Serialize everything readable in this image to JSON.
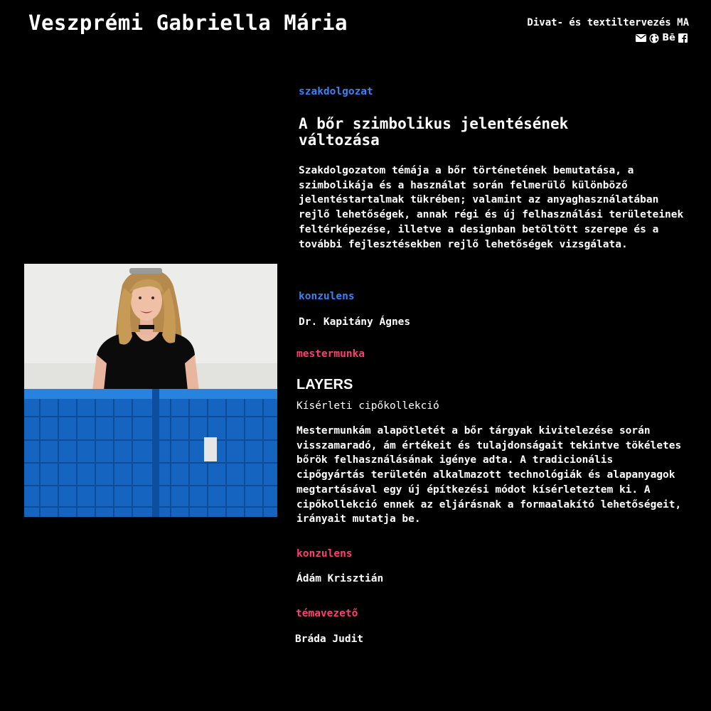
{
  "header": {
    "name": "Veszprémi Gabriella Mária",
    "program": "Divat- és textiltervezés MA",
    "social_icons": [
      "envelope-icon",
      "globe-icon",
      "behance-icon",
      "facebook-icon"
    ],
    "behance_label": "Bē"
  },
  "colors": {
    "background": "#000000",
    "thesis_accent": "#3b82f6",
    "masterwork_accent": "#ff3d6e",
    "text": "#ffffff"
  },
  "thesis": {
    "label": "szakdolgozat",
    "title": "A bőr szimbolikus jelentésének változása",
    "description": "Szakdolgozatom témája a bőr történetének bemutatása, a szimbolikája és a használat során felmerülő különböző jelentéstartalmak tükrében; valamint az anyaghasználatában rejlő lehetőségek, annak régi és új felhasználási területeinek feltérképezése, illetve a designban betöltött szerepe és a további fejlesztésekben rejlő lehetőségek vizsgálata.",
    "consultant_label": "konzulens",
    "consultant": "Dr. Kapitány Ágnes"
  },
  "masterwork": {
    "label": "mestermunka",
    "title": "LAYERS",
    "subtitle": "Kísérleti cipőkollekció",
    "description": "Mestermunkám alapötletét a bőr tárgyak kivitelezése során visszamaradó, ám értékeit és tulajdonságait tekintve tökéletes bőrök felhasználásának igénye adta. A tradicionális cipőgyártás területén alkalmazott technológiák és alapanyagok megtartásával egy új építkezési módot kísérleteztem ki. A cipőkollekció ennek az eljárásnak a formaalakító lehetőségeit, irányait mutatja be.",
    "consultant_label": "konzulens",
    "consultant": "Ádám Krisztián",
    "supervisor_label": "témavezető",
    "supervisor": "Bráda Judit"
  }
}
